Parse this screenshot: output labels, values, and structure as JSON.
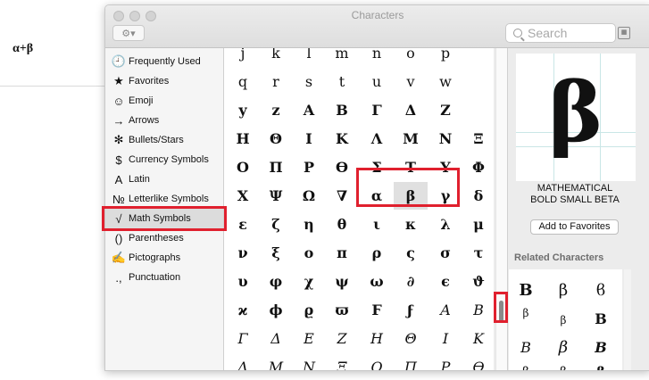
{
  "document": {
    "text": "α+β"
  },
  "window": {
    "title": "Characters",
    "search_placeholder": "Search",
    "gear_label": "⚙▾",
    "grid_label": "▦"
  },
  "categories": [
    {
      "icon": "🕘",
      "label": "Frequently Used"
    },
    {
      "icon": "★",
      "label": "Favorites"
    },
    {
      "icon": "☺",
      "label": "Emoji"
    },
    {
      "icon": "→",
      "label": "Arrows"
    },
    {
      "icon": "✻",
      "label": "Bullets/Stars"
    },
    {
      "icon": "$",
      "label": "Currency Symbols"
    },
    {
      "icon": "A",
      "label": "Latin"
    },
    {
      "icon": "№",
      "label": "Letterlike Symbols"
    },
    {
      "icon": "√",
      "label": "Math Symbols"
    },
    {
      "icon": "()",
      "label": "Parentheses"
    },
    {
      "icon": "✍",
      "label": "Pictographs"
    },
    {
      "icon": ".,",
      "label": "Punctuation"
    }
  ],
  "selected_category": "Math Symbols",
  "grid": [
    [
      "j",
      "k",
      "l",
      "m",
      "n",
      "o",
      "p"
    ],
    [
      "q",
      "r",
      "s",
      "t",
      "u",
      "v",
      "w"
    ],
    [
      "y",
      "z",
      "A",
      "B",
      "Γ",
      "Δ",
      "Z"
    ],
    [
      "H",
      "Θ",
      "I",
      "K",
      "Λ",
      "M",
      "N",
      "Ξ"
    ],
    [
      "O",
      "Π",
      "P",
      "ϴ",
      "Σ",
      "T",
      "Υ",
      "Φ"
    ],
    [
      "X",
      "Ψ",
      "Ω",
      "∇",
      "α",
      "β",
      "γ",
      "δ"
    ],
    [
      "ε",
      "ζ",
      "η",
      "θ",
      "ι",
      "κ",
      "λ",
      "μ"
    ],
    [
      "ν",
      "ξ",
      "ο",
      "π",
      "ρ",
      "ς",
      "σ",
      "τ"
    ],
    [
      "υ",
      "φ",
      "χ",
      "ψ",
      "ω",
      "∂",
      "ϵ",
      "ϑ"
    ],
    [
      "ϰ",
      "ϕ",
      "ϱ",
      "ϖ",
      "Ϝ",
      "ϝ",
      "A",
      "B"
    ],
    [
      "Γ",
      "Δ",
      "E",
      "Z",
      "H",
      "Θ",
      "I",
      "K"
    ],
    [
      "Λ",
      "M",
      "N",
      "Ξ",
      "O",
      "Π",
      "P",
      "ϴ"
    ]
  ],
  "selected_char": "β",
  "preview": {
    "glyph": "β",
    "name_line1": "MATHEMATICAL",
    "name_line2": "BOLD SMALL BETA",
    "add_favorites": "Add to Favorites"
  },
  "related": {
    "header": "Related Characters",
    "items": [
      "B",
      "β",
      "ϐ",
      "β",
      "β",
      "B",
      "B",
      "β",
      "B",
      "β",
      "β",
      "β"
    ]
  }
}
